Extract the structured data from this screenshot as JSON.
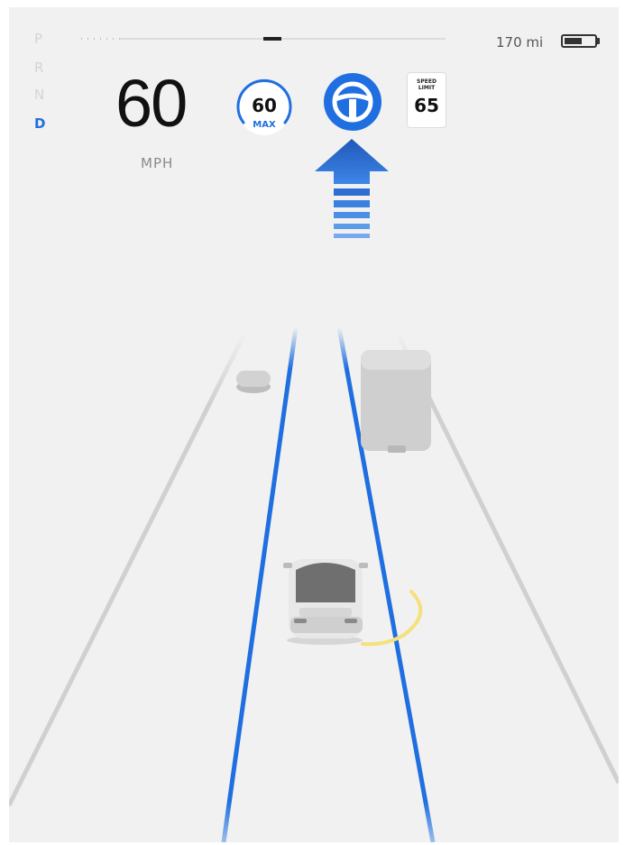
{
  "gear_selector": {
    "gears": [
      "P",
      "R",
      "N",
      "D"
    ],
    "active": "D"
  },
  "speedometer": {
    "value": "60",
    "unit": "MPH"
  },
  "status_bar": {
    "range": "170 mi",
    "battery_level": 0.6
  },
  "cruise_control": {
    "set_speed": "60",
    "label": "MAX"
  },
  "autosteer": {
    "state": "active",
    "icon": "steering-wheel-icon"
  },
  "speed_limit": {
    "label": "SPEED\nLIMIT",
    "value": "65"
  },
  "lane_change": {
    "direction": "up",
    "icon": "lane-change-arrow-icon"
  },
  "colors": {
    "accent_blue": "#1f6fe0",
    "yellow_warning": "#f5e07a",
    "background": "#f1f1f1"
  }
}
